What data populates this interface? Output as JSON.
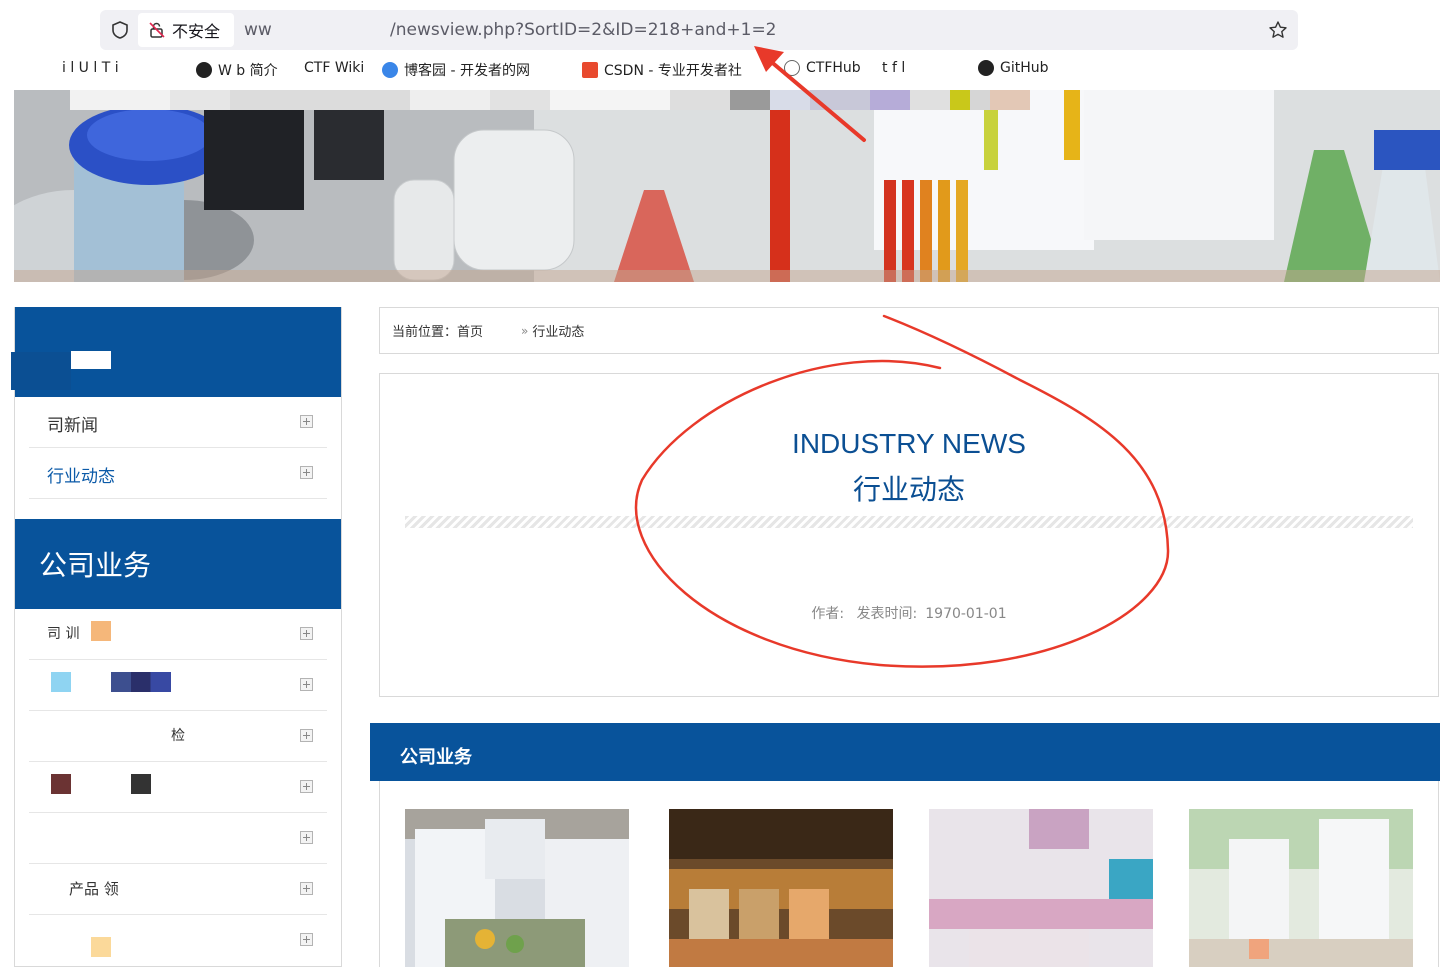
{
  "browser": {
    "insecure_label": "不安全",
    "url_prefix": "ww",
    "url_path": "/newsview.php?SortID=2&ID=218+and+1=2",
    "bookmarks": [
      {
        "label": "i l U l T i",
        "color": "#999999"
      },
      {
        "label": "W  b 简介",
        "color": "#222222"
      },
      {
        "label": "CTF Wiki",
        "color": "#ffffff"
      },
      {
        "label": "博客园 - 开发者的网",
        "color": "#3a86e8"
      },
      {
        "label": "CSDN - 专业开发者社",
        "color": "#e84a2e"
      },
      {
        "label": "CTFHub",
        "color": "#666666"
      },
      {
        "label": "t f l",
        "color": "#222222"
      },
      {
        "label": "GitHub",
        "color": "#222222"
      }
    ]
  },
  "sidebar": {
    "items": [
      {
        "label": "司新闻",
        "active": false
      },
      {
        "label": "行业动态",
        "active": true
      }
    ],
    "business_title": "公司业务",
    "business_items": [
      {
        "label": "司  训"
      },
      {
        "label": ""
      },
      {
        "label": "检"
      },
      {
        "label": ""
      },
      {
        "label": ""
      },
      {
        "label": "产品  领"
      },
      {
        "label": ""
      }
    ]
  },
  "breadcrumb": {
    "prefix": "当前位置：",
    "home": "首页",
    "sep": "»",
    "current": "行业动态"
  },
  "article": {
    "title_en": "INDUSTRY NEWS",
    "title_cn": "行业动态",
    "author_label": "作者:",
    "date_label": "发表时间:",
    "date_value": "1970-01-01"
  },
  "business": {
    "title": "公司业务"
  },
  "colors": {
    "brand_blue": "#08539b",
    "title_blue": "#0b4f93",
    "annotation_red": "#e8392a"
  }
}
